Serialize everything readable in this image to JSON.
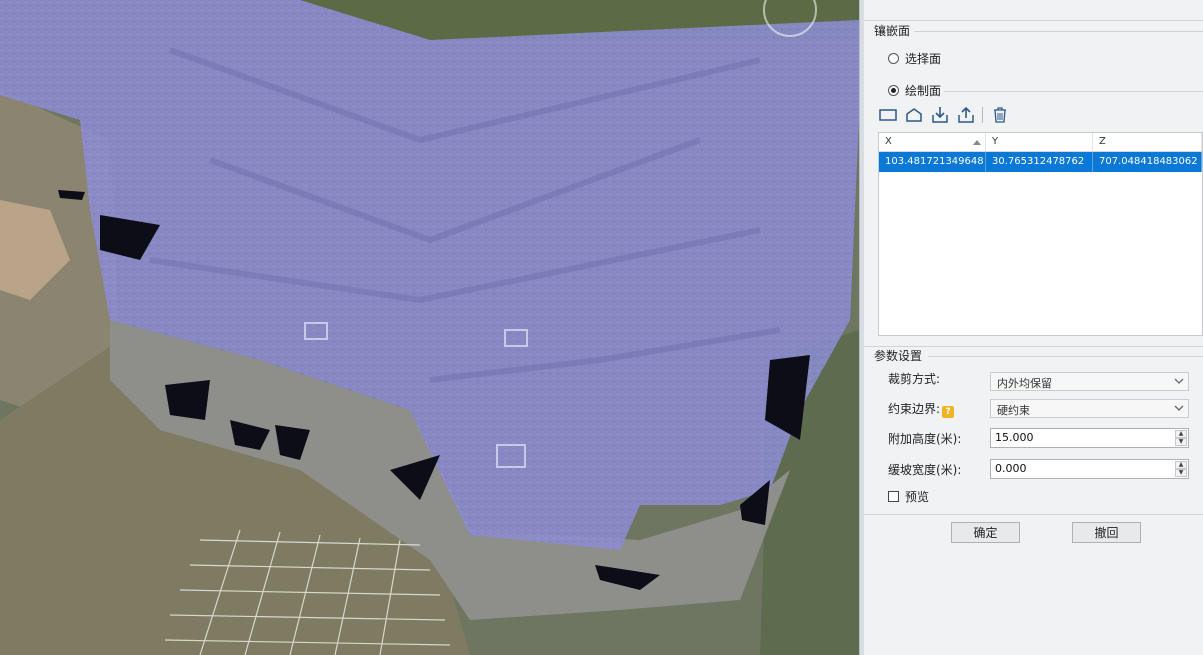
{
  "inlay": {
    "group_title": "镶嵌面",
    "option_select": "选择面",
    "option_draw": "绘制面",
    "selected_option": "option_draw",
    "toolbar_icons": [
      "rectangle-icon",
      "polygon-icon",
      "import-icon",
      "export-icon",
      "delete-icon"
    ],
    "columns": [
      "X",
      "Y",
      "Z"
    ],
    "rows": [
      [
        "103.481721349648",
        "30.765312478762",
        "707.048418483062"
      ]
    ]
  },
  "params": {
    "group_title": "参数设置",
    "clip_mode_label": "裁剪方式:",
    "clip_mode_value": "内外均保留",
    "constraint_label": "约束边界:",
    "constraint_value": "硬约束",
    "extra_height_label": "附加高度(米):",
    "extra_height_value": "15.000",
    "slope_width_label": "缓坡宽度(米):",
    "slope_width_value": "0.000",
    "preview_label": "预览",
    "preview_checked": false
  },
  "buttons": {
    "ok": "确定",
    "undo": "撤回"
  },
  "colors": {
    "selection_row": "#0a78d7",
    "overlay": "#8c8cd2",
    "panel_bg": "#f1f2f4"
  }
}
